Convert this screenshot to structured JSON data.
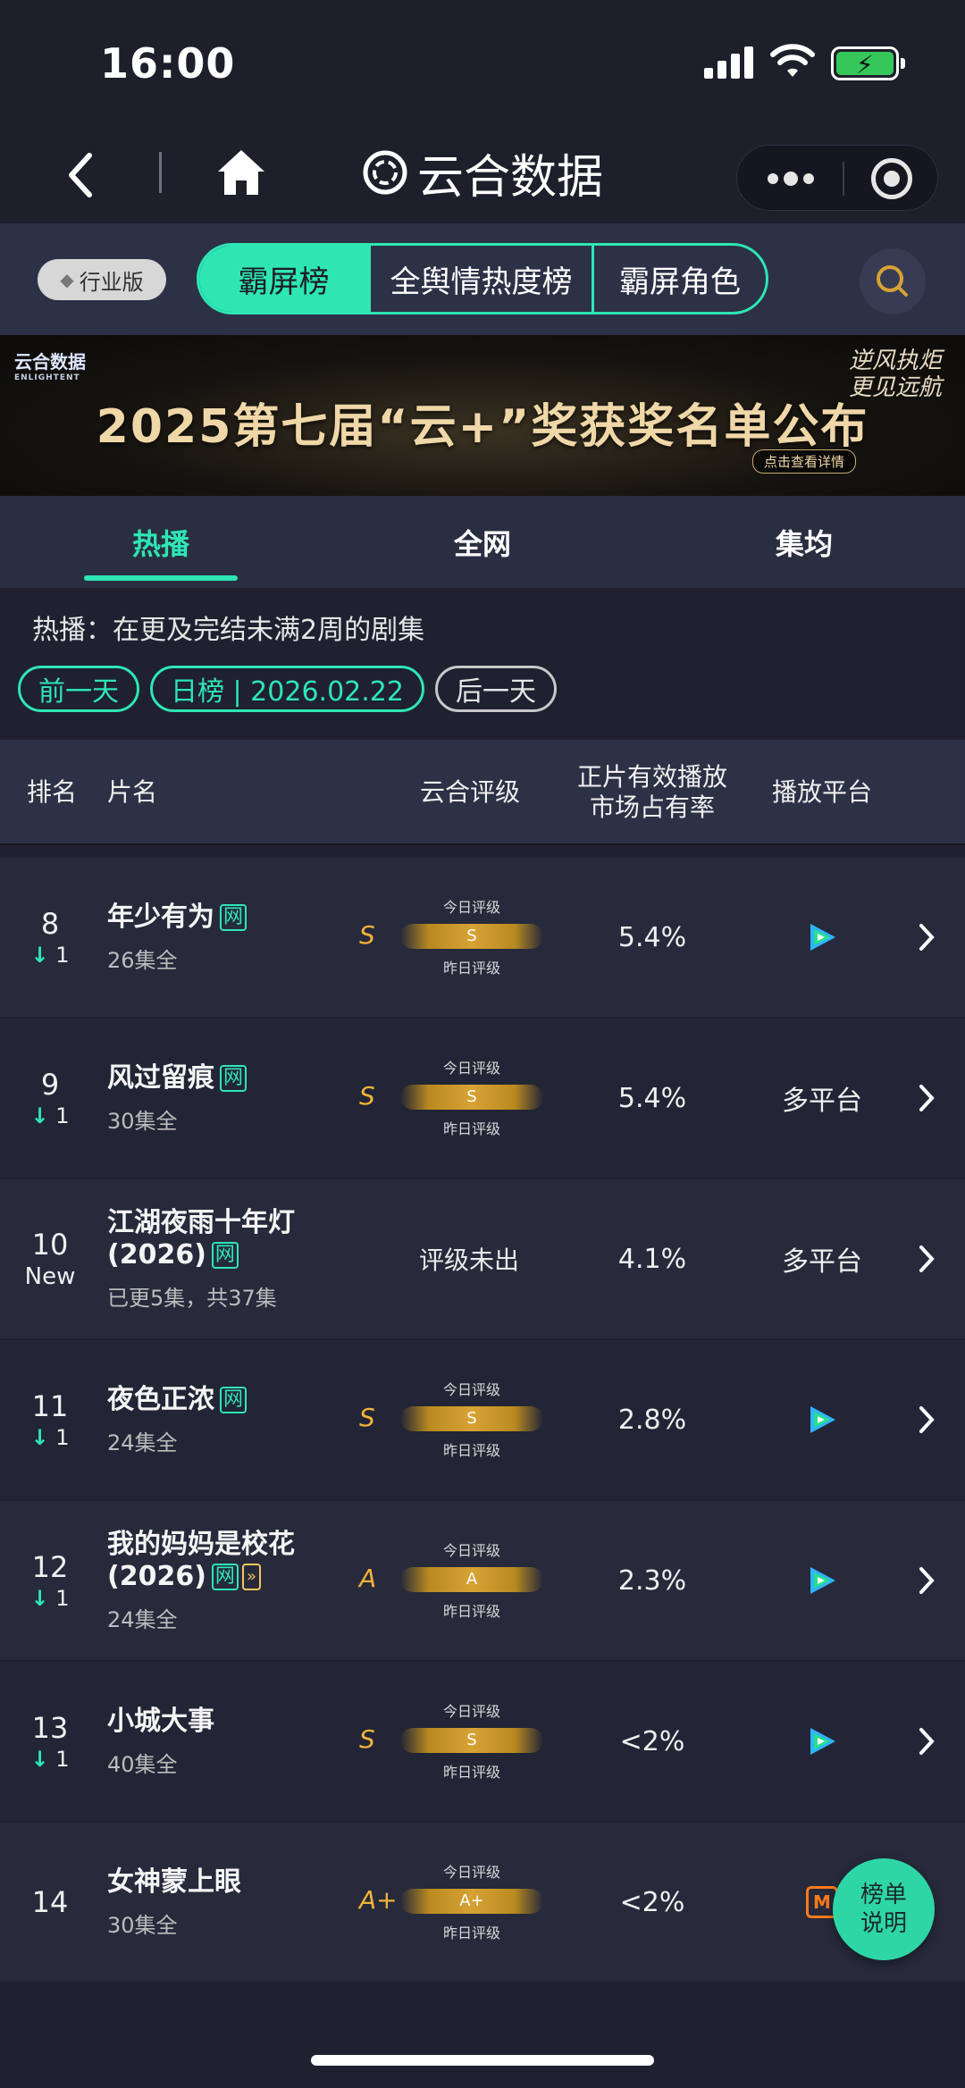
{
  "status": {
    "time": "16:00"
  },
  "nav": {
    "title": "云合数据"
  },
  "tabs": {
    "edition": "行业版",
    "segments": [
      "霸屏榜",
      "全舆情热度榜",
      "霸屏角色"
    ],
    "active": "霸屏榜"
  },
  "banner": {
    "logo": "云合数据",
    "logo_en": "ENLIGHTENT",
    "title": "2025第七届“云+”奖获奖名单公布",
    "cta": "点击查看详情",
    "slogan_1": "逆风执炬",
    "slogan_2": "更见远航"
  },
  "sub_tabs": [
    "热播",
    "全网",
    "集均"
  ],
  "description": "热播：在更及完结未满2周的剧集",
  "date": {
    "prev": "前一天",
    "current": "日榜 | 2026.02.22",
    "next": "后一天"
  },
  "table": {
    "headers": {
      "rank": "排名",
      "title": "片名",
      "rating": "云合评级",
      "share_1": "正片有效播放",
      "share_2": "市场占有率",
      "platform": "播放平台"
    },
    "rating_today_label": "今日评级",
    "rating_yest_label": "昨日评级",
    "rating_none": "评级未出",
    "rows": [
      {
        "rank": "8",
        "change": "1",
        "title": "年少有为",
        "eps": "26集全",
        "rating": "S",
        "share": "5.4%",
        "platform": "tencent"
      },
      {
        "rank": "9",
        "change": "1",
        "title": "风过留痕",
        "eps": "30集全",
        "rating": "S",
        "share": "5.4%",
        "platform": "多平台"
      },
      {
        "rank": "10",
        "change": "New",
        "title": "江湖夜雨十年灯",
        "title2": "(2026)",
        "eps": "已更5集，共37集",
        "rating": "",
        "share": "4.1%",
        "platform": "多平台"
      },
      {
        "rank": "11",
        "change": "1",
        "title": "夜色正浓",
        "eps": "24集全",
        "rating": "S",
        "share": "2.8%",
        "platform": "tencent"
      },
      {
        "rank": "12",
        "change": "1",
        "title": "我的妈妈是校花",
        "title2": "(2026)",
        "eps": "24集全",
        "rating": "A",
        "share": "2.3%",
        "platform": "tencent"
      },
      {
        "rank": "13",
        "change": "1",
        "title": "小城大事",
        "eps": "40集全",
        "rating": "S",
        "share": "<2%",
        "platform": "tencent"
      },
      {
        "rank": "14",
        "change": "",
        "title": "女神蒙上眼",
        "eps": "30集全",
        "rating": "A+",
        "share": "<2%",
        "platform": "mango"
      }
    ]
  },
  "badges": {
    "net": "网",
    "fwd": "»"
  },
  "float_button": {
    "line1": "榜单",
    "line2": "说明"
  },
  "colors": {
    "accent": "#2ee6b4",
    "rating_gold": "#f5b23a",
    "background": "#1f2130"
  }
}
